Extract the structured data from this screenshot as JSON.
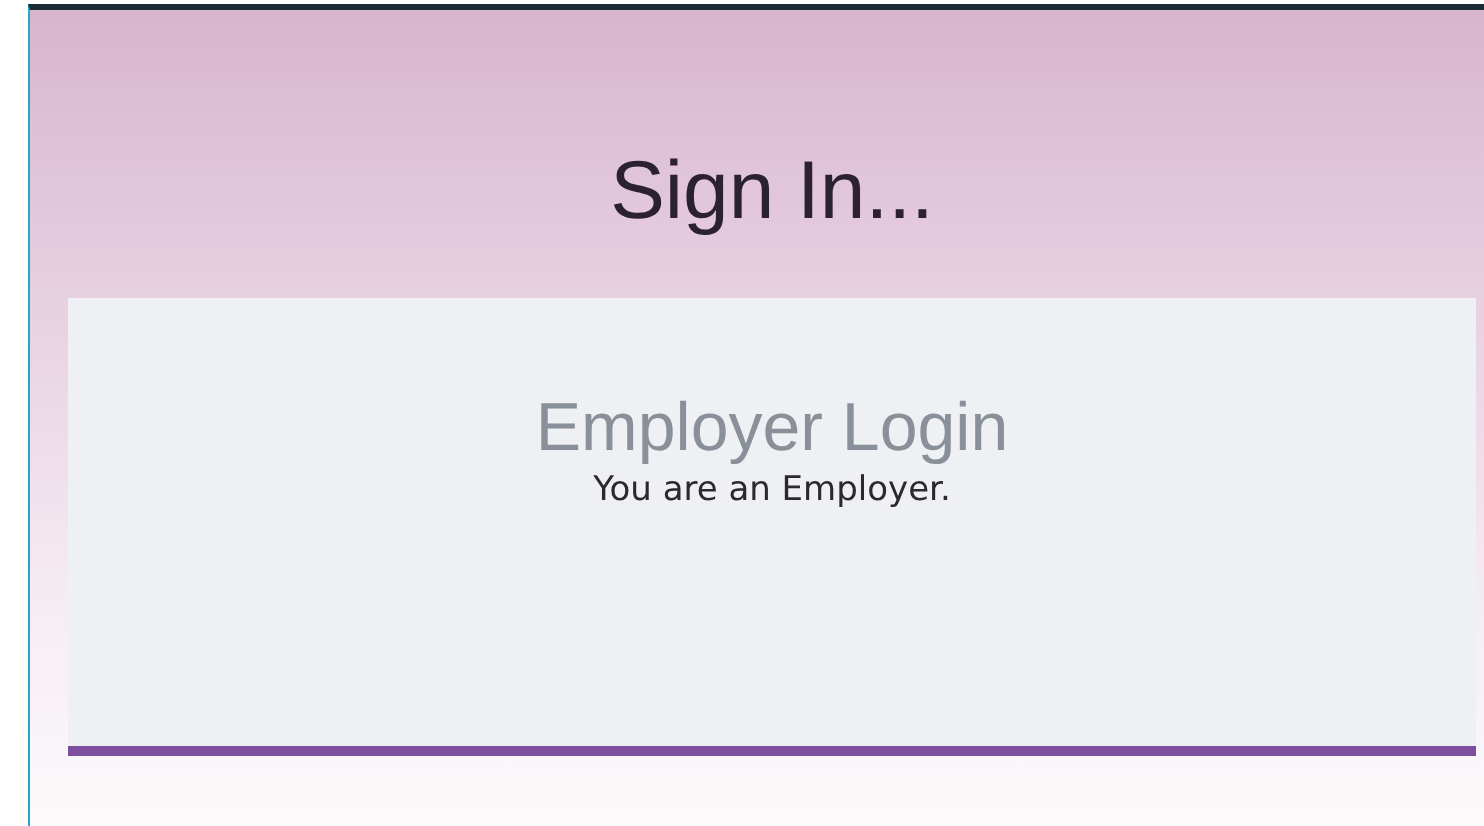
{
  "page": {
    "title": "Sign In..."
  },
  "login_option": {
    "title": "Employer Login",
    "description": "You are an Employer."
  }
}
